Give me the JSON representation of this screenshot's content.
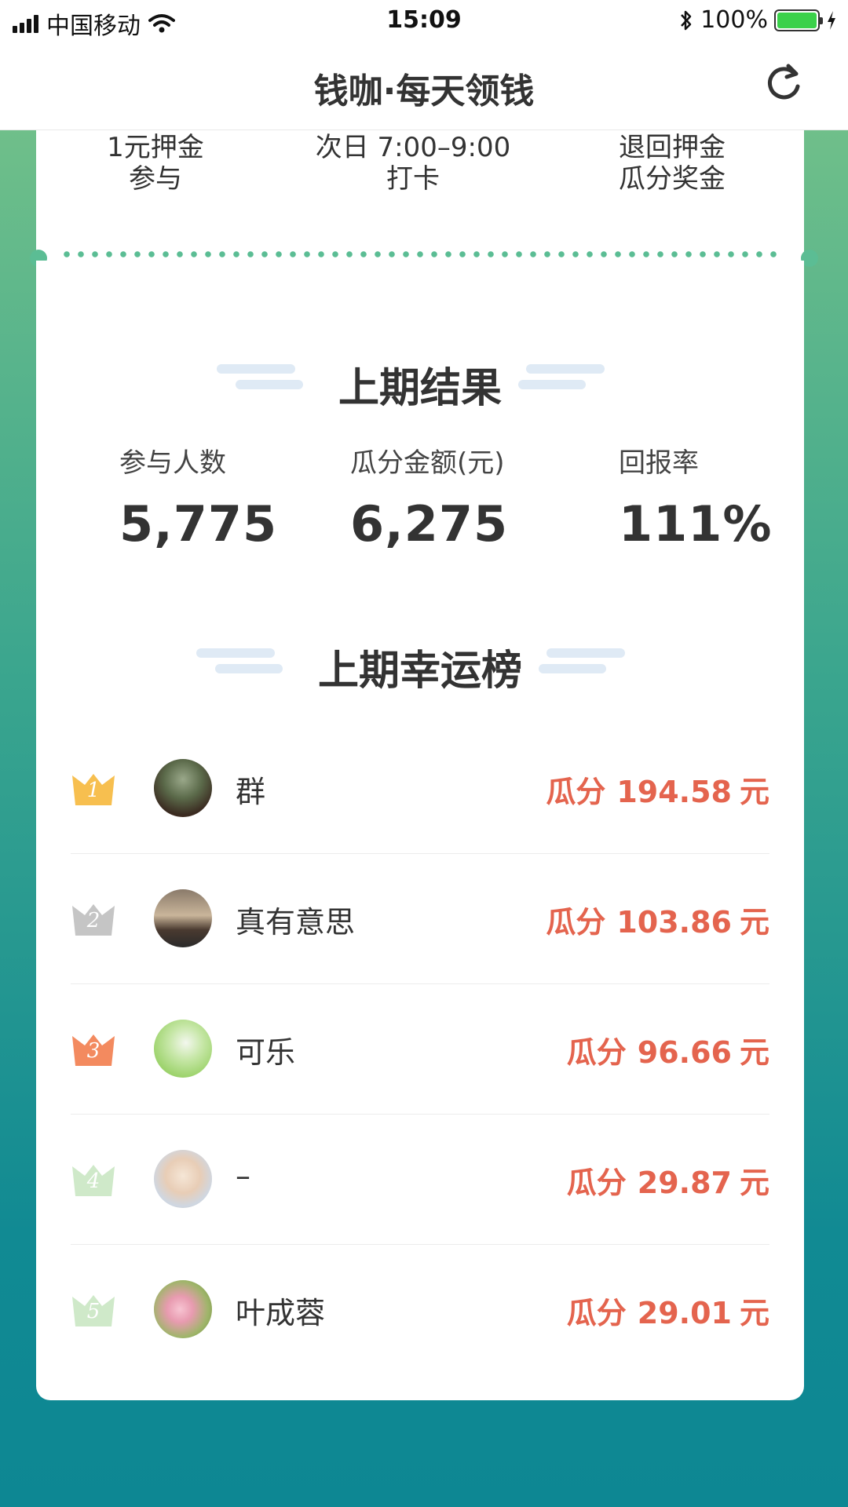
{
  "status_bar": {
    "carrier": "中国移动",
    "time": "15:09",
    "battery": "100%"
  },
  "nav": {
    "title": "钱咖·每天领钱",
    "refresh_icon": "refresh-icon"
  },
  "steps": [
    {
      "line1": "1元押金",
      "line2": "参与"
    },
    {
      "line1": "次日 7:00–9:00",
      "line2": "打卡"
    },
    {
      "line1": "退回押金",
      "line2": "瓜分奖金"
    }
  ],
  "last_results": {
    "title": "上期结果",
    "stats": [
      {
        "label": "参与人数",
        "value": "5,775"
      },
      {
        "label": "瓜分金额(元)",
        "value": "6,275"
      },
      {
        "label": "回报率",
        "value": "111%"
      }
    ]
  },
  "lucky_board": {
    "title": "上期幸运榜",
    "prefix": "瓜分",
    "unit": "元",
    "items": [
      {
        "rank": "1",
        "name": "群",
        "amount": "194.58",
        "crown_color": "#f7bf4f"
      },
      {
        "rank": "2",
        "name": "真有意思",
        "amount": "103.86",
        "crown_color": "#c5c5c5"
      },
      {
        "rank": "3",
        "name": "可乐",
        "amount": "96.66",
        "crown_color": "#f38a5f"
      },
      {
        "rank": "4",
        "name": "–",
        "amount": "29.87",
        "crown_color": "#cfe9c9"
      },
      {
        "rank": "5",
        "name": "叶成蓉",
        "amount": "29.01",
        "crown_color": "#cfe9c9"
      }
    ]
  },
  "colors": {
    "accent_red": "#e4644e",
    "green_dots": "#5bbd94"
  }
}
